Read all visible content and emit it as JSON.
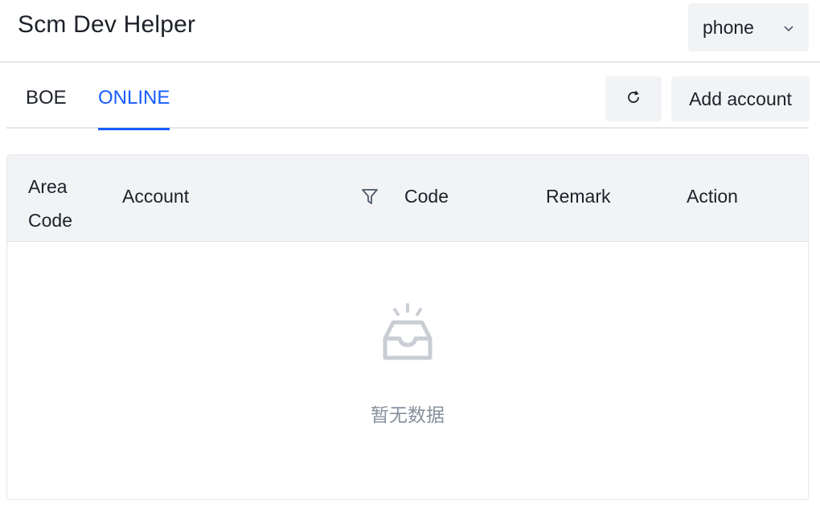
{
  "header": {
    "title": "Scm Dev Helper",
    "select": {
      "value": "phone",
      "icon": "chevron-down-icon"
    }
  },
  "tabs": [
    {
      "label": "BOE",
      "active": false
    },
    {
      "label": "ONLINE",
      "active": true
    }
  ],
  "toolbar": {
    "refresh_icon": "refresh-icon",
    "add_label": "Add account"
  },
  "table": {
    "columns": [
      "Area Code",
      "Account",
      "Code",
      "Remark",
      "Action"
    ],
    "filter_icon": "filter-icon",
    "rows": [],
    "empty_text": "暂无数据"
  },
  "colors": {
    "accent": "#165dff",
    "muted_bg": "#f2f3f5",
    "border": "#e5e6eb",
    "empty_text": "#86909c"
  }
}
